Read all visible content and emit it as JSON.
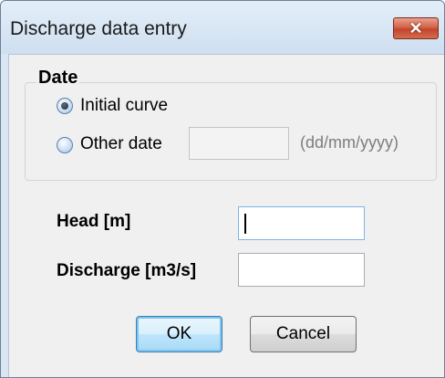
{
  "window": {
    "title": "Discharge data entry",
    "close_label": "✕"
  },
  "date_group": {
    "label": "Date",
    "options": [
      {
        "label": "Initial curve",
        "selected": true
      },
      {
        "label": "Other date",
        "selected": false
      }
    ],
    "date_value": "",
    "date_hint": "(dd/mm/yyyy)"
  },
  "fields": {
    "head_label": "Head [m]",
    "head_value": "",
    "discharge_label": "Discharge [m3/s]",
    "discharge_value": ""
  },
  "buttons": {
    "ok_label": "OK",
    "cancel_label": "Cancel"
  }
}
